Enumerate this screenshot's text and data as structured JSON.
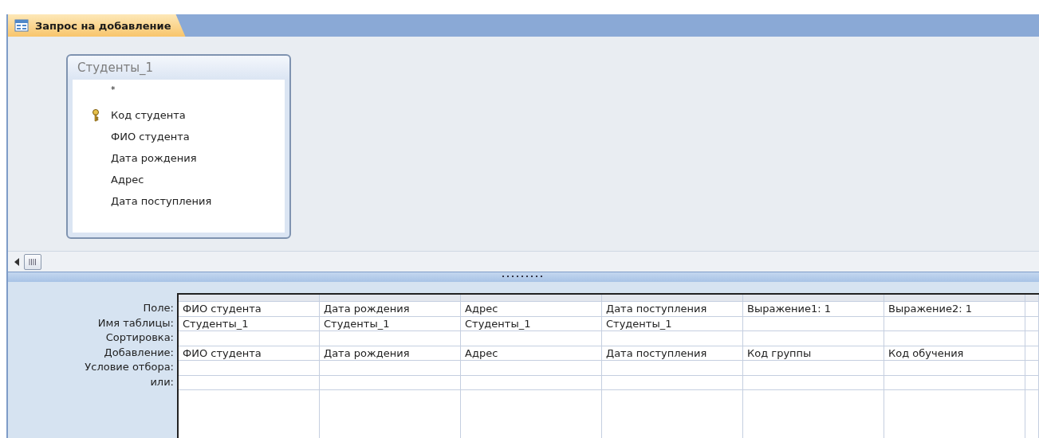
{
  "tab": {
    "title": "Запрос на добавление",
    "selected": true
  },
  "table_box": {
    "title": "Студенты_1",
    "fields": [
      {
        "name": "*",
        "primary_key": false
      },
      {
        "name": "Код студента",
        "primary_key": true
      },
      {
        "name": "ФИО студента",
        "primary_key": false
      },
      {
        "name": "Дата рождения",
        "primary_key": false
      },
      {
        "name": "Адрес",
        "primary_key": false
      },
      {
        "name": "Дата поступления",
        "primary_key": false
      }
    ]
  },
  "grid": {
    "rows": [
      {
        "label": "Поле:",
        "cells": [
          "ФИО студента",
          "Дата рождения",
          "Адрес",
          "Дата поступления",
          "Выражение1: 1",
          "Выражение2: 1"
        ]
      },
      {
        "label": "Имя таблицы:",
        "cells": [
          "Студенты_1",
          "Студенты_1",
          "Студенты_1",
          "Студенты_1",
          null,
          null
        ]
      },
      {
        "label": "Сортировка:",
        "cells": [
          null,
          null,
          null,
          null,
          null,
          null
        ]
      },
      {
        "label": "Добавление:",
        "cells": [
          "ФИО студента",
          "Дата рождения",
          "Адрес",
          "Дата поступления",
          "Код группы",
          "Код обучения"
        ]
      },
      {
        "label": "Условие отбора:",
        "cells": [
          null,
          null,
          null,
          null,
          null,
          null
        ]
      },
      {
        "label": "или:",
        "cells": [
          null,
          null,
          null,
          null,
          null,
          null
        ]
      }
    ]
  }
}
